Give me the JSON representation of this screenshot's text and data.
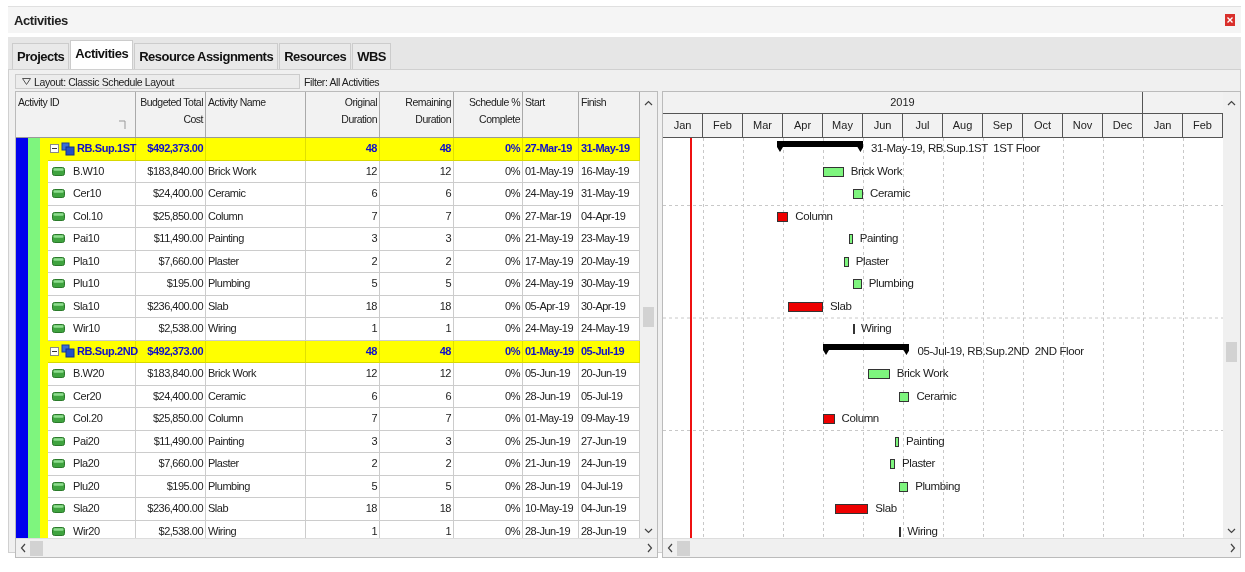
{
  "window": {
    "title": "Activities"
  },
  "tabs": [
    {
      "label": "Projects",
      "selected": false
    },
    {
      "label": "Activities",
      "selected": true
    },
    {
      "label": "Resource Assignments",
      "selected": false
    },
    {
      "label": "Resources",
      "selected": false
    },
    {
      "label": "WBS",
      "selected": false
    }
  ],
  "layout_bar": {
    "layout": "Layout: Classic Schedule Layout",
    "filter": "Filter: All Activities"
  },
  "table": {
    "columns": [
      "Activity ID",
      "Budgeted Total Cost",
      "Activity Name",
      "Original Duration",
      "Remaining Duration",
      "Schedule % Complete",
      "Start",
      "Finish"
    ],
    "rows": [
      {
        "activity_id": "RB.Sup.1ST",
        "budgeted_total_cost": "$492,373.00",
        "original_duration": "48",
        "remaining_duration": "48",
        "schedule_pct_complete": "0%",
        "start": "27-Mar-19",
        "finish": "31-May-19",
        "expanded": true,
        "bar_label": "31-May-19, RB.Sup.1ST  1ST Floor",
        "children": [
          {
            "activity_id": "B.W10",
            "budgeted_total_cost": "$183,840.00",
            "activity_name": "Brick Work",
            "original_duration": "12",
            "remaining_duration": "12",
            "schedule_pct_complete": "0%",
            "start": "01-May-19",
            "finish": "16-May-19",
            "critical": false,
            "bar_label": "Brick Work"
          },
          {
            "activity_id": "Cer10",
            "budgeted_total_cost": "$24,400.00",
            "activity_name": "Ceramic",
            "original_duration": "6",
            "remaining_duration": "6",
            "schedule_pct_complete": "0%",
            "start": "24-May-19",
            "finish": "31-May-19",
            "critical": false,
            "bar_label": "Ceramic"
          },
          {
            "activity_id": "Col.10",
            "budgeted_total_cost": "$25,850.00",
            "activity_name": "Column",
            "original_duration": "7",
            "remaining_duration": "7",
            "schedule_pct_complete": "0%",
            "start": "27-Mar-19",
            "finish": "04-Apr-19",
            "critical": true,
            "bar_label": "Column"
          },
          {
            "activity_id": "Pai10",
            "budgeted_total_cost": "$11,490.00",
            "activity_name": "Painting",
            "original_duration": "3",
            "remaining_duration": "3",
            "schedule_pct_complete": "0%",
            "start": "21-May-19",
            "finish": "23-May-19",
            "critical": false,
            "bar_label": "Painting"
          },
          {
            "activity_id": "Pla10",
            "budgeted_total_cost": "$7,660.00",
            "activity_name": "Plaster",
            "original_duration": "2",
            "remaining_duration": "2",
            "schedule_pct_complete": "0%",
            "start": "17-May-19",
            "finish": "20-May-19",
            "critical": false,
            "bar_label": "Plaster"
          },
          {
            "activity_id": "Plu10",
            "budgeted_total_cost": "$195.00",
            "activity_name": "Plumbing",
            "original_duration": "5",
            "remaining_duration": "5",
            "schedule_pct_complete": "0%",
            "start": "24-May-19",
            "finish": "30-May-19",
            "critical": false,
            "bar_label": "Plumbing"
          },
          {
            "activity_id": "Sla10",
            "budgeted_total_cost": "$236,400.00",
            "activity_name": "Slab",
            "original_duration": "18",
            "remaining_duration": "18",
            "schedule_pct_complete": "0%",
            "start": "05-Apr-19",
            "finish": "30-Apr-19",
            "critical": true,
            "bar_label": "Slab"
          },
          {
            "activity_id": "Wir10",
            "budgeted_total_cost": "$2,538.00",
            "activity_name": "Wiring",
            "original_duration": "1",
            "remaining_duration": "1",
            "schedule_pct_complete": "0%",
            "start": "24-May-19",
            "finish": "24-May-19",
            "critical": false,
            "bar_label": "Wiring"
          }
        ]
      },
      {
        "activity_id": "RB.Sup.2ND",
        "budgeted_total_cost": "$492,373.00",
        "original_duration": "48",
        "remaining_duration": "48",
        "schedule_pct_complete": "0%",
        "start": "01-May-19",
        "finish": "05-Jul-19",
        "expanded": true,
        "bar_label": "05-Jul-19, RB.Sup.2ND  2ND Floor",
        "children": [
          {
            "activity_id": "B.W20",
            "budgeted_total_cost": "$183,840.00",
            "activity_name": "Brick Work",
            "original_duration": "12",
            "remaining_duration": "12",
            "schedule_pct_complete": "0%",
            "start": "05-Jun-19",
            "finish": "20-Jun-19",
            "critical": false,
            "bar_label": "Brick Work"
          },
          {
            "activity_id": "Cer20",
            "budgeted_total_cost": "$24,400.00",
            "activity_name": "Ceramic",
            "original_duration": "6",
            "remaining_duration": "6",
            "schedule_pct_complete": "0%",
            "start": "28-Jun-19",
            "finish": "05-Jul-19",
            "critical": false,
            "bar_label": "Ceramic"
          },
          {
            "activity_id": "Col.20",
            "budgeted_total_cost": "$25,850.00",
            "activity_name": "Column",
            "original_duration": "7",
            "remaining_duration": "7",
            "schedule_pct_complete": "0%",
            "start": "01-May-19",
            "finish": "09-May-19",
            "critical": true,
            "bar_label": "Column"
          },
          {
            "activity_id": "Pai20",
            "budgeted_total_cost": "$11,490.00",
            "activity_name": "Painting",
            "original_duration": "3",
            "remaining_duration": "3",
            "schedule_pct_complete": "0%",
            "start": "25-Jun-19",
            "finish": "27-Jun-19",
            "critical": false,
            "bar_label": "Painting"
          },
          {
            "activity_id": "Pla20",
            "budgeted_total_cost": "$7,660.00",
            "activity_name": "Plaster",
            "original_duration": "2",
            "remaining_duration": "2",
            "schedule_pct_complete": "0%",
            "start": "21-Jun-19",
            "finish": "24-Jun-19",
            "critical": false,
            "bar_label": "Plaster"
          },
          {
            "activity_id": "Plu20",
            "budgeted_total_cost": "$195.00",
            "activity_name": "Plumbing",
            "original_duration": "5",
            "remaining_duration": "5",
            "schedule_pct_complete": "0%",
            "start": "28-Jun-19",
            "finish": "04-Jul-19",
            "critical": false,
            "bar_label": "Plumbing"
          },
          {
            "activity_id": "Sla20",
            "budgeted_total_cost": "$236,400.00",
            "activity_name": "Slab",
            "original_duration": "18",
            "remaining_duration": "18",
            "schedule_pct_complete": "0%",
            "start": "10-May-19",
            "finish": "04-Jun-19",
            "critical": true,
            "bar_label": "Slab"
          },
          {
            "activity_id": "Wir20",
            "budgeted_total_cost": "$2,538.00",
            "activity_name": "Wiring",
            "original_duration": "1",
            "remaining_duration": "1",
            "schedule_pct_complete": "0%",
            "start": "28-Jun-19",
            "finish": "28-Jun-19",
            "critical": false,
            "bar_label": "Wiring"
          }
        ]
      }
    ]
  },
  "gantt": {
    "year": "2019",
    "months": [
      "Jan",
      "Feb",
      "Mar",
      "Apr",
      "May",
      "Jun",
      "Jul",
      "Aug",
      "Sep",
      "Oct",
      "Nov",
      "Dec",
      "Jan",
      "Feb"
    ]
  }
}
